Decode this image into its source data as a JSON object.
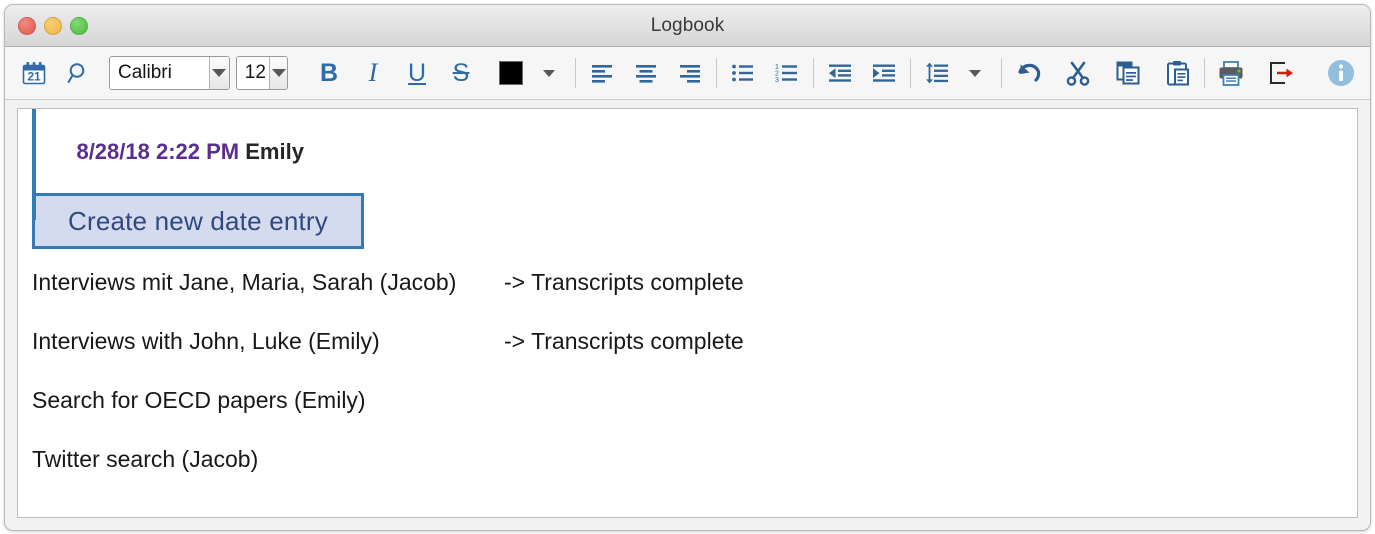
{
  "window": {
    "title": "Logbook",
    "controls": [
      {
        "name": "close",
        "color": "#e2584d"
      },
      {
        "name": "minimize",
        "color": "#eeb53c"
      },
      {
        "name": "maximize",
        "color": "#4fba3c"
      }
    ]
  },
  "toolbar": {
    "calendar_icon_label": "21",
    "calendar_tooltip": "Insert date entry",
    "search_tooltip": "Search",
    "font": {
      "value": "Calibri",
      "label": "Font"
    },
    "size": {
      "value": "12",
      "label": "Font size"
    },
    "bold": "B",
    "italic": "I",
    "underline": "U",
    "strikethrough": "S",
    "font_color": "#000000",
    "font_color_label": "Font color",
    "align_left": "Align left",
    "align_center": "Align center",
    "align_right": "Align right",
    "bullet_list": "Bulleted list",
    "numbered_list": "Numbered list",
    "numbered_list_digits": [
      "1",
      "2",
      "3"
    ],
    "decrease_indent": "Decrease indent",
    "increase_indent": "Increase indent",
    "line_spacing": "Line spacing",
    "undo": "Undo",
    "cut": "Cut",
    "copy": "Copy",
    "paste": "Paste",
    "print": "Print",
    "export": "Export",
    "info": "Info",
    "accent_color": "#2e6ba8"
  },
  "document": {
    "header": {
      "date": "8/28/18 2:22 PM",
      "user": "Emily",
      "date_color": "#5b2d91"
    },
    "entry_button": {
      "label": "Create new date entry",
      "background": "#d4dbef",
      "border": "#3579b5",
      "text_color": "#31497e"
    },
    "rows": [
      {
        "task": "Interviews mit Jane, Maria, Sarah (Jacob)",
        "status": "-> Transcripts complete"
      },
      {
        "task": "Interviews with John, Luke (Emily)",
        "status": "-> Transcripts complete"
      },
      {
        "task": "Search for OECD papers (Emily)",
        "status": ""
      },
      {
        "task": "Twitter search (Jacob)",
        "status": ""
      }
    ]
  }
}
